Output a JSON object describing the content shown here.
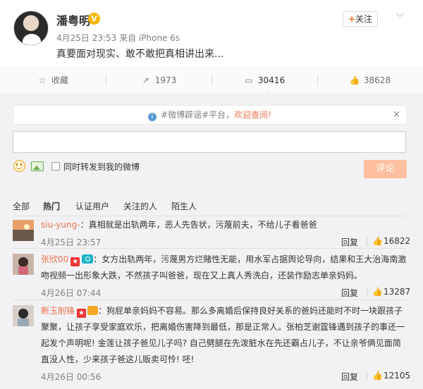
{
  "post": {
    "author": "潘粤明",
    "verified_badge": "V",
    "meta": "4月25日 23:53 来自 iPhone 6s",
    "text": "真要面对现实、敢不敢把真相讲出来...",
    "follow_label": "关注",
    "follow_plus": "+",
    "more_glyph": "⌵"
  },
  "actions": {
    "favorite_label": "收藏",
    "repost_count": "1973",
    "comment_count": "30416",
    "like_count": "38628"
  },
  "comment_box": {
    "notice_prefix": "#微博辟谣#平台，",
    "notice_link": "欢迎查阅!",
    "notice_close": "×",
    "input_value": "",
    "sync_label": "同时转发到我的微博",
    "submit_label": "评论"
  },
  "filters": {
    "items": [
      "全部",
      "热门",
      "认证用户",
      "关注的人",
      "陌生人"
    ],
    "active": "热门"
  },
  "comments": [
    {
      "user": "siu-yung-",
      "text": "：真相就是出轨两年，恶人先告状，污蔑前夫，不给儿子看爸爸",
      "time": "4月25日 23:57",
      "reply_label": "回复",
      "likes": "16822"
    },
    {
      "user": "张欣00",
      "text_line1": "：女方出轨两年，污蔑男方烂赌性无能，用水军占据舆论导向，结果和王大治海南激",
      "text_line2": "吻视频一出形象大跌，不然孩子叫爸爸，现在又上真人秀洗白，还装作励志单亲妈妈。",
      "time": "4月26日 07:44",
      "reply_label": "回复",
      "likes": "13287"
    },
    {
      "user": "断玉削锋",
      "text_line1": "：狗屁单亲妈妈不容易。那么多离婚后保持良好关系的爸妈还能时不时一块跟孩子",
      "text_line2": "聚聚，让孩子享受家庭欢乐，把离婚伤害降到最低，那是正常人。张柏芝谢霆锋遇到孩子的事还一",
      "text_line3": "起发个声明呢! 金莲让孩子爸见儿子吗? 自己劈腿在先泼脏水在先还霸占儿子，不让亲爷俩见面简",
      "text_line4": "直没人性，少来孩子爸这儿贩卖可怜! 呸!",
      "time": "4月26日 00:56",
      "reply_label": "回复",
      "likes": "12105"
    }
  ],
  "icons": {
    "star": "☆",
    "repost": "↗",
    "comment": "▭",
    "like": "👍"
  },
  "colors": {
    "accent": "#eb7350",
    "submit_disabled": "#ffc09f",
    "verified": "#f5b700",
    "panel_bg": "#f2f2f5"
  }
}
